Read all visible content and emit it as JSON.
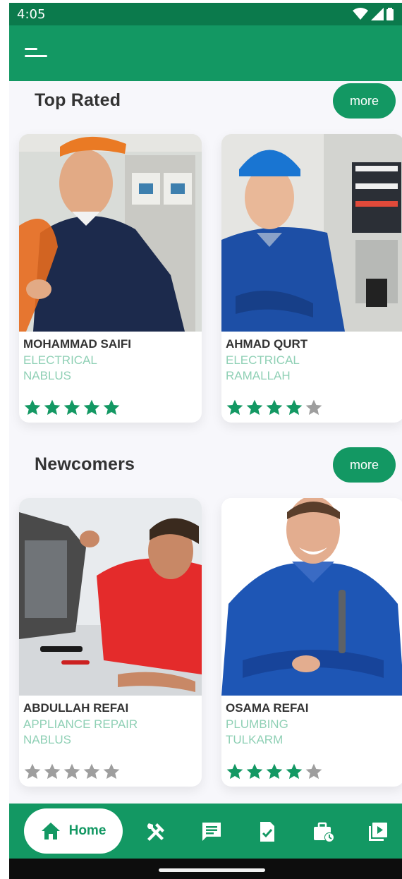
{
  "status_bar": {
    "time": "4:05"
  },
  "sections": [
    {
      "title": "Top Rated",
      "more_label": "more",
      "cards": [
        {
          "name": "MOHAMMAD SAIFI",
          "category": "ELECTRICAL",
          "city": "NABLUS",
          "rating": 5
        },
        {
          "name": "AHMAD QURT",
          "category": "ELECTRICAL",
          "city": "RAMALLAH",
          "rating": 4
        }
      ]
    },
    {
      "title": "Newcomers",
      "more_label": "more",
      "cards": [
        {
          "name": "ABDULLAH REFAI",
          "category": "APPLIANCE REPAIR",
          "city": "NABLUS",
          "rating": 0
        },
        {
          "name": "OSAMA REFAI",
          "category": "PLUMBING",
          "city": "TULKARM",
          "rating": 4
        }
      ]
    }
  ],
  "bottom_nav": {
    "home_label": "Home",
    "icons": [
      "tools-icon",
      "message-icon",
      "document-check-icon",
      "briefcase-clock-icon",
      "video-library-icon"
    ]
  },
  "colors": {
    "primary": "#139863",
    "status": "#0b7a4c",
    "star_on": "#139863",
    "star_off": "#9e9e9e",
    "subtext": "#8fd0b5"
  }
}
